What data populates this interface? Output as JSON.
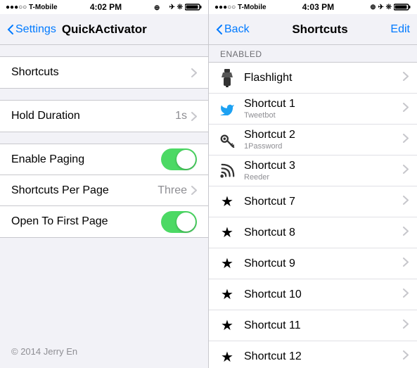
{
  "left": {
    "statusBar": {
      "signal": "●●●○○ T-Mobile",
      "time": "4:02 PM",
      "icons": "⊕ ✈ ❊ 🔋"
    },
    "nav": {
      "backLabel": "Settings",
      "title": "QuickActivator"
    },
    "rows": [
      {
        "id": "shortcuts",
        "label": "Shortcuts",
        "rightText": "",
        "hasChevron": true,
        "hasToggle": false,
        "type": "link"
      },
      {
        "id": "hold-duration",
        "label": "Hold Duration",
        "rightText": "1s",
        "hasChevron": true,
        "hasToggle": false,
        "type": "value"
      },
      {
        "id": "enable-paging",
        "label": "Enable Paging",
        "rightText": "",
        "hasChevron": false,
        "hasToggle": true,
        "type": "toggle"
      },
      {
        "id": "shortcuts-per-page",
        "label": "Shortcuts Per Page",
        "rightText": "Three",
        "hasChevron": true,
        "hasToggle": false,
        "type": "value"
      },
      {
        "id": "open-to-first",
        "label": "Open To First Page",
        "rightText": "",
        "hasChevron": false,
        "hasToggle": true,
        "type": "toggle"
      }
    ],
    "footer": "© 2014 Jerry En"
  },
  "right": {
    "statusBar": {
      "signal": "●●●○○ T-Mobile",
      "time": "4:03 PM",
      "icons": "⊕ ✈ ❊ 🔋"
    },
    "nav": {
      "backLabel": "Back",
      "title": "Shortcuts",
      "editLabel": "Edit"
    },
    "sectionHeader": "ENABLED",
    "items": [
      {
        "id": "flashlight",
        "icon": "flashlight",
        "title": "Flashlight",
        "subtitle": "",
        "hasChevron": true
      },
      {
        "id": "shortcut1",
        "icon": "twitter",
        "title": "Shortcut 1",
        "subtitle": "Tweetbot",
        "hasChevron": true
      },
      {
        "id": "shortcut2",
        "icon": "key",
        "title": "Shortcut 2",
        "subtitle": "1Password",
        "hasChevron": true
      },
      {
        "id": "shortcut3",
        "icon": "rss",
        "title": "Shortcut 3",
        "subtitle": "Reeder",
        "hasChevron": true
      },
      {
        "id": "shortcut7",
        "icon": "star",
        "title": "Shortcut 7",
        "subtitle": "",
        "hasChevron": true
      },
      {
        "id": "shortcut8",
        "icon": "star",
        "title": "Shortcut 8",
        "subtitle": "",
        "hasChevron": true
      },
      {
        "id": "shortcut9",
        "icon": "star",
        "title": "Shortcut 9",
        "subtitle": "",
        "hasChevron": true
      },
      {
        "id": "shortcut10",
        "icon": "star",
        "title": "Shortcut 10",
        "subtitle": "",
        "hasChevron": true
      },
      {
        "id": "shortcut11",
        "icon": "star",
        "title": "Shortcut 11",
        "subtitle": "",
        "hasChevron": true
      },
      {
        "id": "shortcut12",
        "icon": "star",
        "title": "Shortcut 12",
        "subtitle": "",
        "hasChevron": true
      }
    ]
  }
}
